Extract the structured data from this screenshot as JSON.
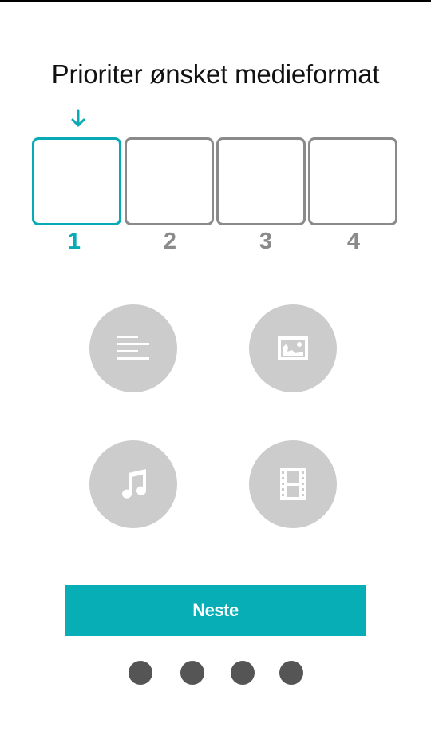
{
  "title": "Prioriter ønsket medieformat",
  "colors": {
    "accent": "#08aab5",
    "inactive": "#8a8a8a",
    "media_button": "#cccccc",
    "dot": "#555555"
  },
  "priority_slots": [
    {
      "number": "1",
      "active": true
    },
    {
      "number": "2",
      "active": false
    },
    {
      "number": "3",
      "active": false
    },
    {
      "number": "4",
      "active": false
    }
  ],
  "current_slot_indicator_icon": "arrow-down-icon",
  "media_options": [
    {
      "name": "text",
      "icon": "text-lines-icon"
    },
    {
      "name": "image",
      "icon": "image-icon"
    },
    {
      "name": "audio",
      "icon": "music-note-icon"
    },
    {
      "name": "video",
      "icon": "film-icon"
    }
  ],
  "next_button": {
    "label": "Neste"
  },
  "page_indicator": {
    "total": 4
  }
}
